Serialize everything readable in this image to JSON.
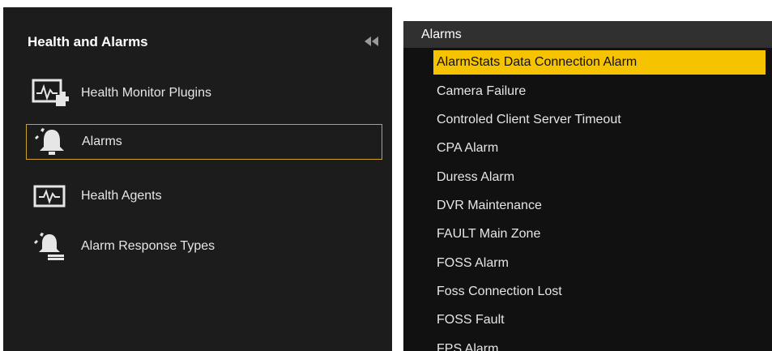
{
  "left_panel": {
    "title": "Health and Alarms",
    "items": [
      {
        "label": "Health Monitor Plugins",
        "icon": "health-monitor-plugin-icon"
      },
      {
        "label": "Alarms",
        "icon": "alarm-bell-icon",
        "selected": true
      },
      {
        "label": "Health Agents",
        "icon": "health-agent-icon"
      },
      {
        "label": "Alarm Response Types",
        "icon": "alarm-response-icon"
      }
    ]
  },
  "right_panel": {
    "header": "Alarms",
    "items": [
      "AlarmStats Data Connection Alarm",
      "Camera Failure",
      "Controled Client Server Timeout",
      "CPA Alarm",
      "Duress Alarm",
      "DVR Maintenance",
      "FAULT Main Zone",
      "FOSS Alarm",
      "Foss Connection Lost",
      "FOSS Fault",
      "FPS Alarm"
    ],
    "selected_index": 0
  },
  "colors": {
    "selection_yellow": "#f6c300",
    "selected_border": "#c9a227",
    "panel_bg": "#1c1c1c"
  }
}
